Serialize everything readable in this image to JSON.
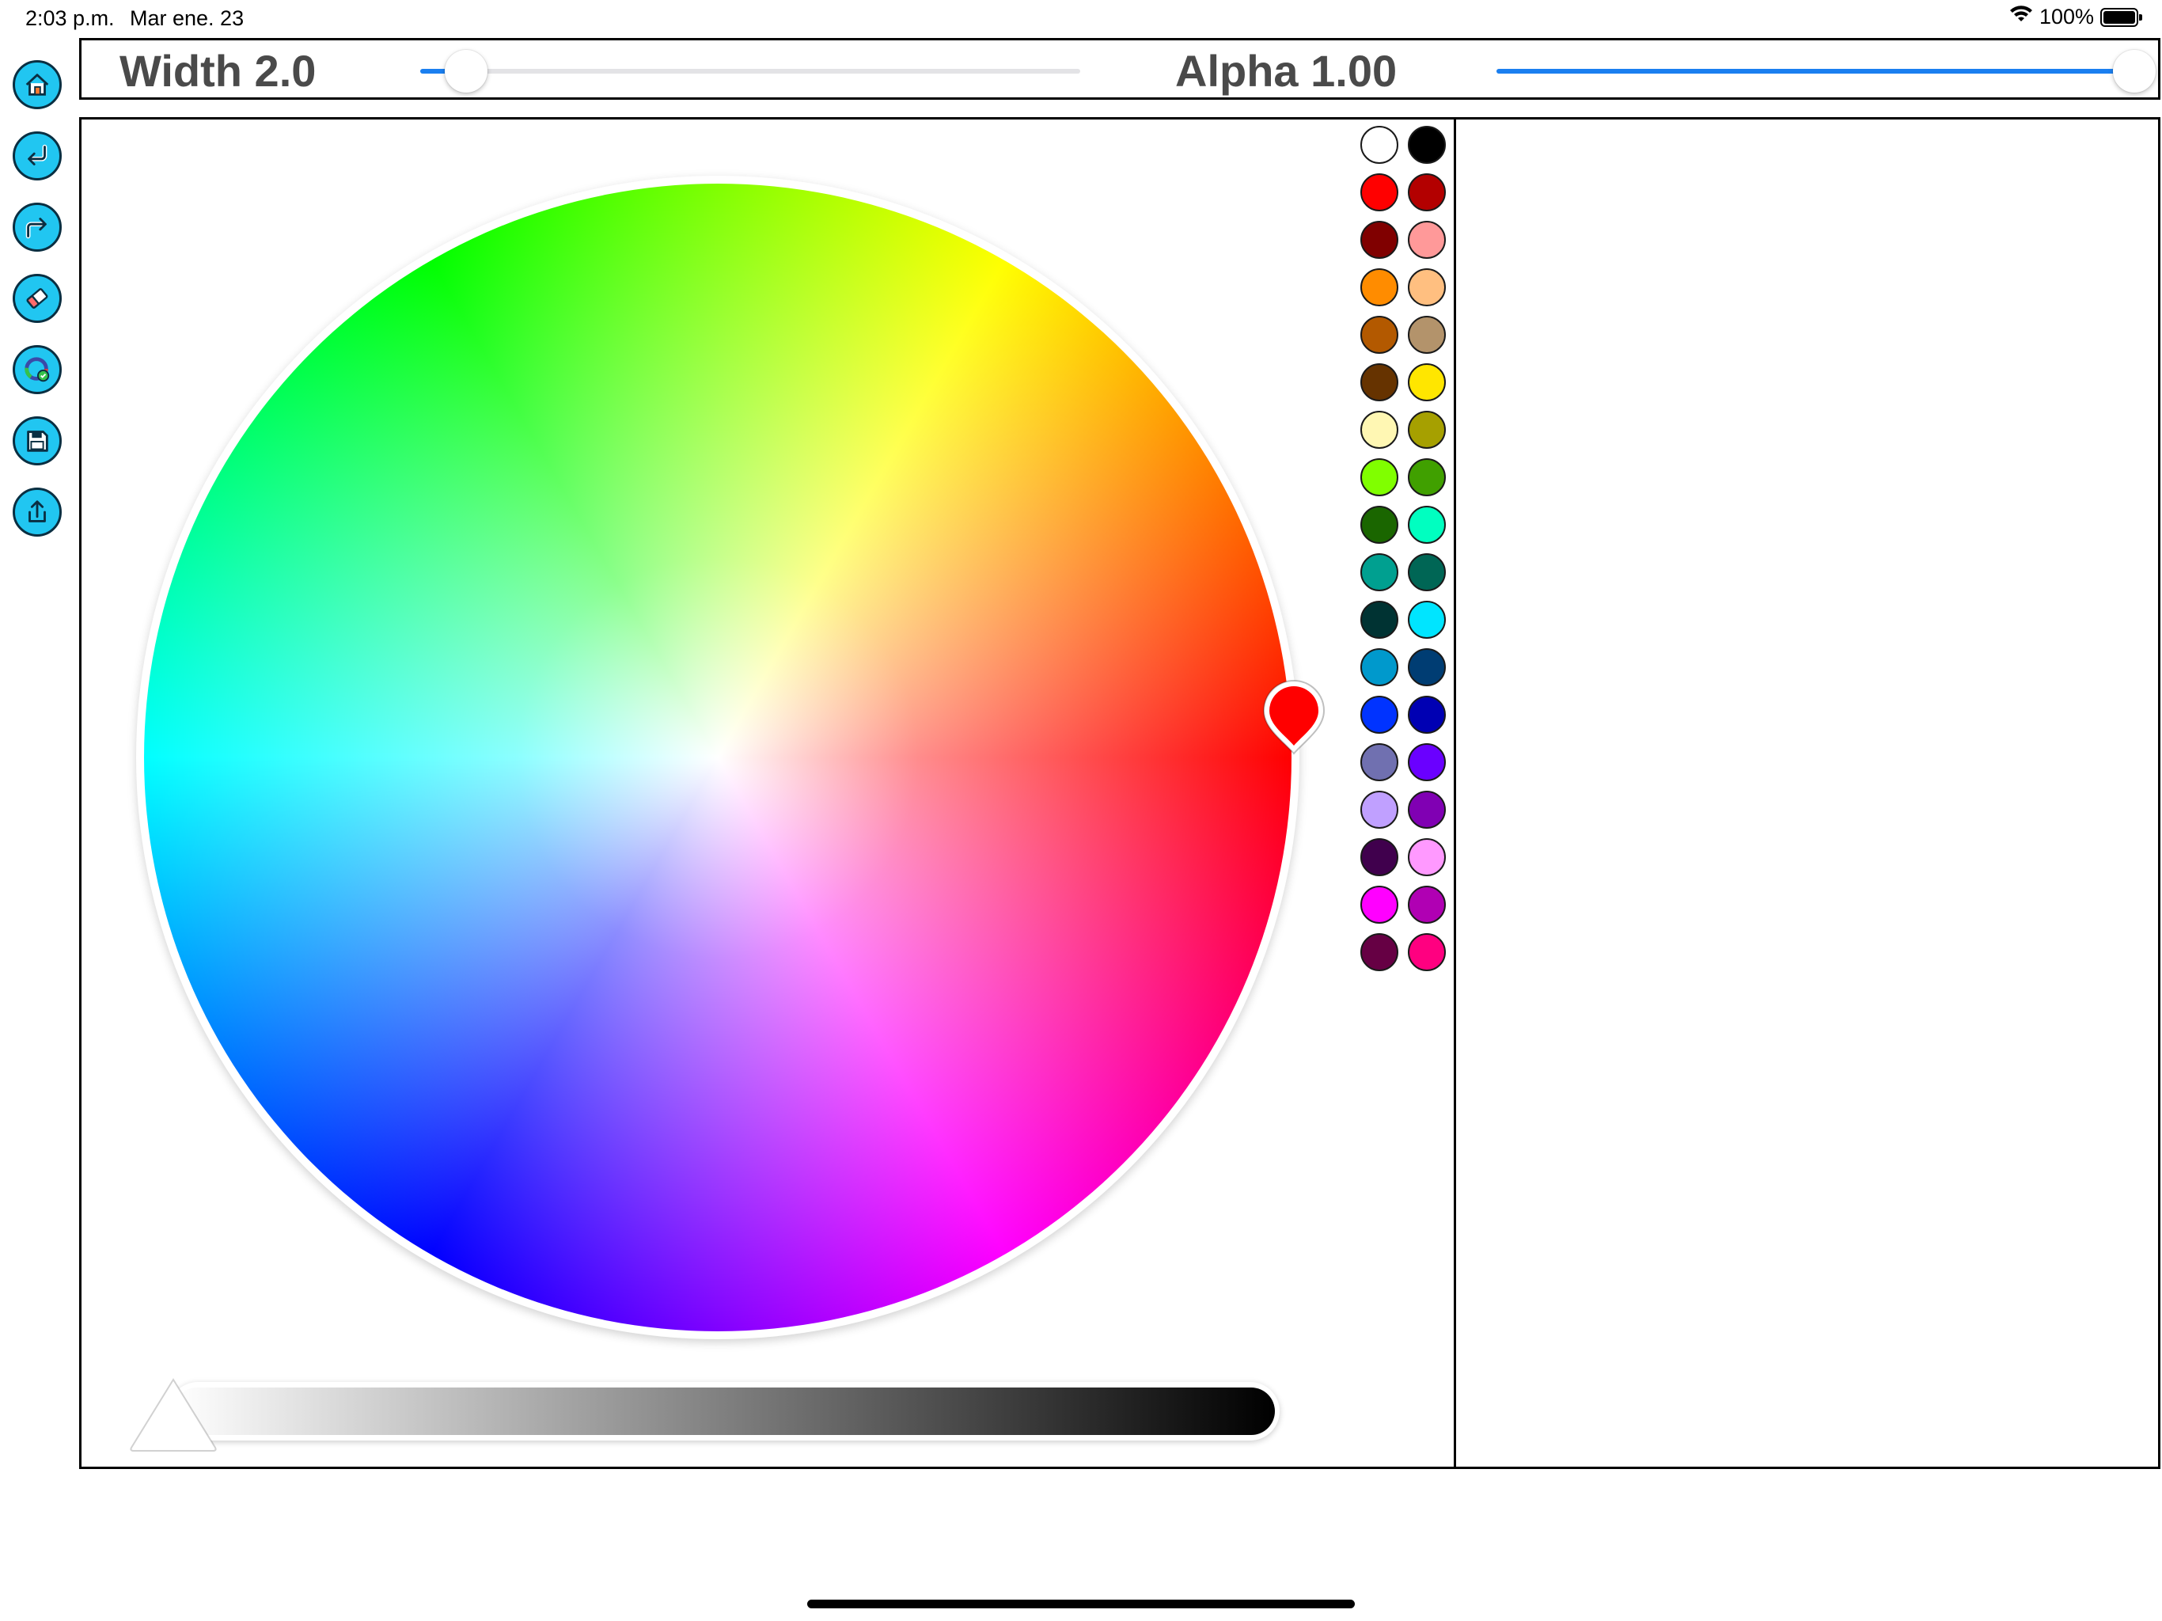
{
  "status_bar": {
    "time": "2:03 p.m.",
    "date": "Mar ene. 23",
    "battery": "100%"
  },
  "toolbar": {
    "items": [
      "home-icon",
      "undo-icon",
      "redo-icon",
      "eraser-icon",
      "color-picker-icon",
      "save-icon",
      "share-icon"
    ]
  },
  "controls": {
    "width_label": "Width 2.0",
    "alpha_label": "Alpha 1.00",
    "width_value_fraction": 0.07,
    "alpha_value_fraction": 1.0,
    "accent_color": "#1a7ff0"
  },
  "color_picker": {
    "selected_color": "#ff0000",
    "brightness_fraction": 0.0,
    "palette": [
      "#ffffff",
      "#000000",
      "#ff0000",
      "#b30000",
      "#800000",
      "#ff9999",
      "#ff8c00",
      "#ffbf80",
      "#b35900",
      "#b3936b",
      "#663300",
      "#ffe600",
      "#fff7b3",
      "#a6a000",
      "#80ff00",
      "#40a000",
      "#1a6600",
      "#00ffc0",
      "#00a090",
      "#006655",
      "#003333",
      "#00e5ff",
      "#0099cc",
      "#003d73",
      "#0033ff",
      "#0000b3",
      "#7070b0",
      "#6a00ff",
      "#c0a0ff",
      "#8000b3",
      "#40004d",
      "#ff99ff",
      "#ff00ff",
      "#b000b3",
      "#660044",
      "#ff0080"
    ]
  }
}
